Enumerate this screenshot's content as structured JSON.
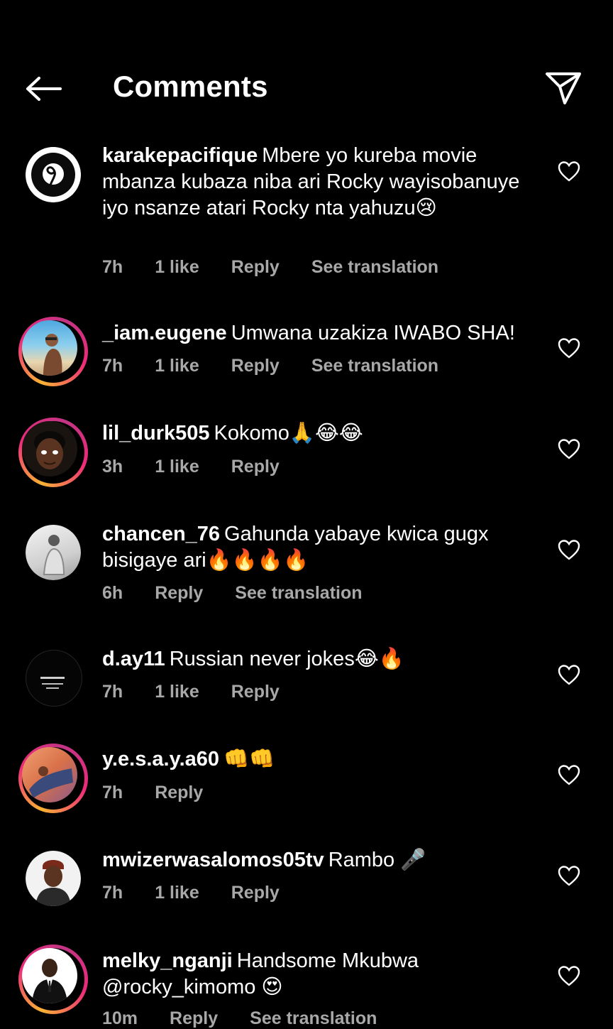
{
  "header": {
    "title": "Comments"
  },
  "comments": [
    {
      "username": "karakepacifique",
      "text": "Mbere yo kureba movie mbanza kubaza niba ari Rocky wayisobanuye iyo nsanze atari Rocky nta yahuzu😢",
      "time": "7h",
      "likes": "1 like",
      "reply": "Reply",
      "translate": "See translation",
      "story": false,
      "avatar": "peacock-logo"
    },
    {
      "username": "_iam.eugene",
      "text": "Umwana uzakiza IWABO SHA!",
      "time": "7h",
      "likes": "1 like",
      "reply": "Reply",
      "translate": "See translation",
      "story": true,
      "avatar": "beach-photo"
    },
    {
      "username": "lil_durk505",
      "text": "Kokomo🙏😂😂",
      "time": "3h",
      "likes": "1 like",
      "reply": "Reply",
      "translate": "",
      "story": true,
      "avatar": "cartoon-face"
    },
    {
      "username": "chancen_76",
      "text": "Gahunda yabaye kwica gugx bisigaye ari🔥🔥🔥🔥",
      "time": "6h",
      "likes": "",
      "reply": "Reply",
      "translate": "See translation",
      "story": false,
      "avatar": "bw-photo"
    },
    {
      "username": "d.ay11",
      "text": "Russian never jokes😂🔥",
      "time": "7h",
      "likes": "1 like",
      "reply": "Reply",
      "translate": "",
      "story": false,
      "avatar": "text-logo"
    },
    {
      "username": "y.e.s.a.y.a60",
      "text": "👊👊",
      "time": "7h",
      "likes": "",
      "reply": "Reply",
      "translate": "",
      "story": true,
      "avatar": "orange-photo"
    },
    {
      "username": "mwizerwasalomos05tv",
      "text": "Rambo 🎤",
      "time": "7h",
      "likes": "1 like",
      "reply": "Reply",
      "translate": "",
      "story": false,
      "avatar": "man-photo"
    },
    {
      "username": "melky_nganji",
      "text": "Handsome Mkubwa @rocky_kimomo 😍",
      "time": "10m",
      "likes": "",
      "reply": "Reply",
      "translate": "See translation",
      "story": true,
      "avatar": "suit-photo"
    }
  ],
  "colors": {
    "background": "#000000",
    "meta_text": "#a8a8a8",
    "story_ring_start": "#f9b233",
    "story_ring_end": "#c13584"
  },
  "icons": {
    "back": "arrow-left-icon",
    "send": "paper-plane-icon",
    "like": "heart-outline-icon"
  }
}
